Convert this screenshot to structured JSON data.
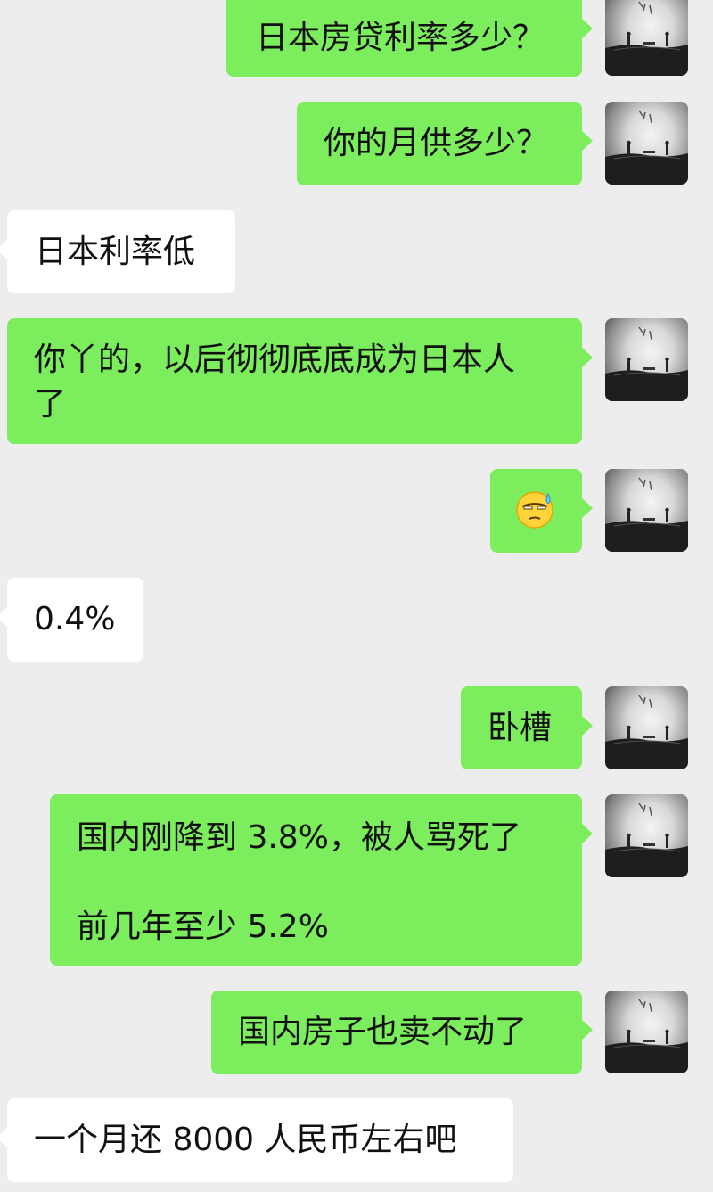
{
  "messages": [
    {
      "side": "me",
      "text": "日本房贷利率多少？"
    },
    {
      "side": "me",
      "text": "你的月供多少？"
    },
    {
      "side": "them",
      "text": "日本利率低"
    },
    {
      "side": "me",
      "text": "你丫的，以后彻彻底底成为日本人\n了"
    },
    {
      "side": "me",
      "emoji": "sweat-emoji"
    },
    {
      "side": "them",
      "text": "0.4%"
    },
    {
      "side": "me",
      "text": "卧槽"
    },
    {
      "side": "me",
      "text": "国内刚降到 3.8%，被人骂死了\n\n前几年至少 5.2%"
    },
    {
      "side": "me",
      "text": "国内房子也卖不动了"
    },
    {
      "side": "them",
      "text": "一个月还 8000 人民币左右吧"
    }
  ],
  "theme": {
    "background": "#ededed",
    "my_bubble": "#7ced5c",
    "their_bubble": "#ffffff"
  }
}
